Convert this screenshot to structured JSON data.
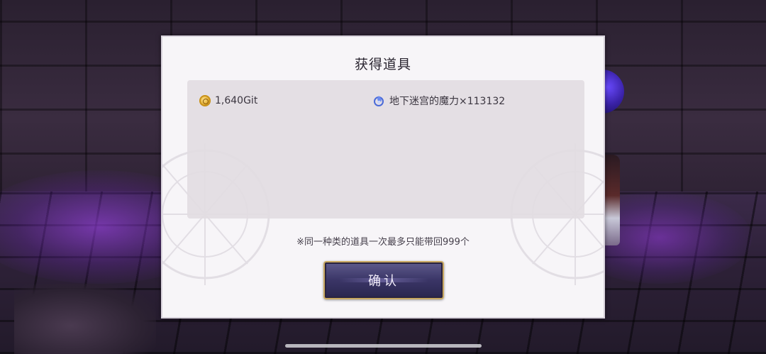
{
  "dialog": {
    "title": "获得道具",
    "items": [
      {
        "icon": "gold-coin-icon",
        "label": "1,640Git"
      },
      {
        "icon": "blue-flame-icon",
        "label": "地下迷宫的魔力×113132"
      }
    ],
    "notice": "※同一种类的道具一次最多只能带回999个",
    "confirm_label": "确认"
  },
  "colors": {
    "dialog_bg": "#f7f5f8",
    "panel_bg": "#e2dce2",
    "button_bg": "#3a3566",
    "button_border": "#c9a860"
  }
}
